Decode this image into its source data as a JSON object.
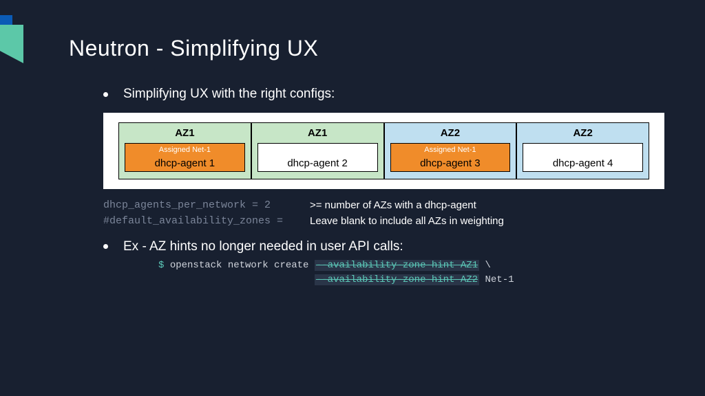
{
  "title": "Neutron - Simplifying UX",
  "bullet1": "Simplifying UX with the right configs:",
  "bullet2": "Ex - AZ hints no longer needed in user API calls:",
  "az": [
    {
      "label": "AZ1",
      "assigned": true,
      "assigned_label": "Assigned Net-1",
      "agent": "dhcp-agent 1",
      "color": "green"
    },
    {
      "label": "AZ1",
      "assigned": false,
      "assigned_label": "",
      "agent": "dhcp-agent 2",
      "color": "green"
    },
    {
      "label": "AZ2",
      "assigned": true,
      "assigned_label": "Assigned Net-1",
      "agent": "dhcp-agent 3",
      "color": "blue"
    },
    {
      "label": "AZ2",
      "assigned": false,
      "assigned_label": "",
      "agent": "dhcp-agent 4",
      "color": "blue"
    }
  ],
  "config": {
    "line1_left": "dhcp_agents_per_network = 2",
    "line1_right": ">= number of AZs with a dhcp-agent",
    "line2_left": "#default_availability_zones =",
    "line2_right": "Leave blank to include all AZs in weighting"
  },
  "code": {
    "prompt": "$ ",
    "cmd": "openstack network create ",
    "strike1": "--availability-zone-hint AZ1",
    "cont": " \\",
    "indent": "                           ",
    "strike2": "--availability-zone-hint AZ2",
    "net": " Net-1"
  }
}
